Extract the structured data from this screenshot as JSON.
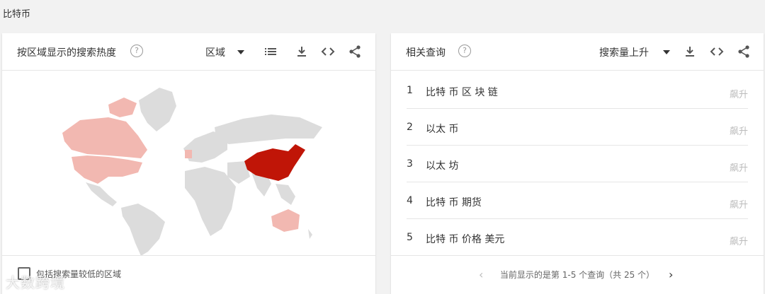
{
  "page": {
    "title": "比特币"
  },
  "left_card": {
    "title": "按区域显示的搜索热度",
    "help": "?",
    "dropdown_label": "区域",
    "footer_checkbox_label": "包括搜索量较低的区域"
  },
  "right_card": {
    "title": "相关查询",
    "help": "?",
    "dropdown_label": "搜索量上升",
    "queries": [
      {
        "rank": "1",
        "text": "比特 币 区 块 链",
        "trend": "飙升"
      },
      {
        "rank": "2",
        "text": "以太 币",
        "trend": "飙升"
      },
      {
        "rank": "3",
        "text": "以太 坊",
        "trend": "飙升"
      },
      {
        "rank": "4",
        "text": "比特 币 期货",
        "trend": "飙升"
      },
      {
        "rank": "5",
        "text": "比特 币 价格 美元",
        "trend": "飙升"
      }
    ],
    "pager_text": "当前显示的是第 1-5 个查询（共 25 个）"
  },
  "watermark": "大数跨境",
  "colors": {
    "highest": "#c01507",
    "light": "#f2b8b1",
    "nodata": "#dcdcdc"
  },
  "icons": [
    "help-icon",
    "list-icon",
    "download-icon",
    "embed-icon",
    "share-icon",
    "chevron-left-icon",
    "chevron-right-icon"
  ]
}
